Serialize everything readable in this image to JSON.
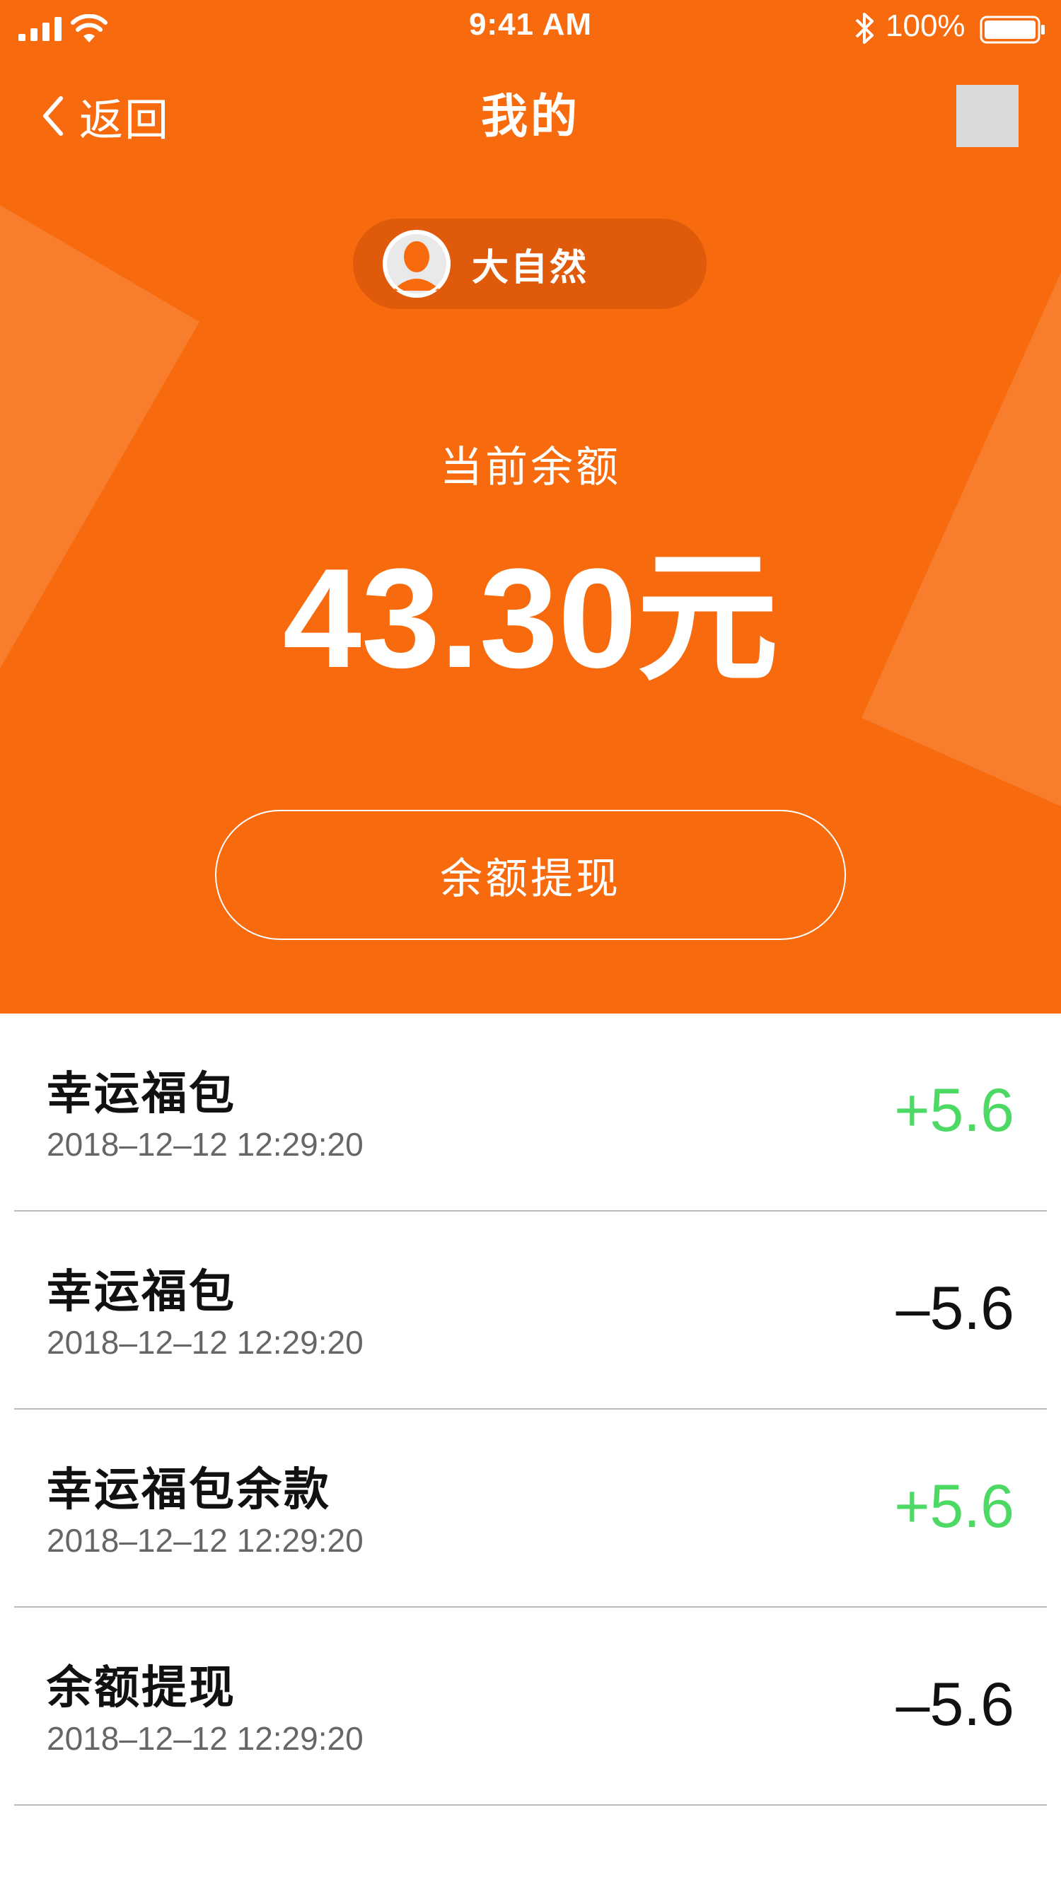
{
  "status_bar": {
    "time": "9:41 AM",
    "battery_percent": "100%",
    "icons": [
      "signal-icon",
      "wifi-icon",
      "bluetooth-icon",
      "battery-icon"
    ]
  },
  "nav": {
    "back_label": "返回",
    "title": "我的",
    "back_icon": "chevron-left-icon"
  },
  "user": {
    "name": "大自然",
    "avatar_icon": "user-avatar-icon"
  },
  "balance": {
    "label": "当前余额",
    "value": "43.30元"
  },
  "withdraw_button": {
    "label": "余额提现"
  },
  "transactions": [
    {
      "title": "幸运福包",
      "time": "2018–12–12 12:29:20",
      "amount": "+5.6",
      "direction": "positive"
    },
    {
      "title": "幸运福包",
      "time": "2018–12–12 12:29:20",
      "amount": "–5.6",
      "direction": "negative"
    },
    {
      "title": "幸运福包余款",
      "time": "2018–12–12 12:29:20",
      "amount": "+5.6",
      "direction": "positive"
    },
    {
      "title": "余额提现",
      "time": "2018–12–12 12:29:20",
      "amount": "–5.6",
      "direction": "negative"
    }
  ],
  "colors": {
    "header_orange": "#f76b0e",
    "pill_orange": "#df5a0b",
    "positive_green": "#4cd964",
    "negative_black": "#111111",
    "placeholder_gray": "#d9d9d9"
  }
}
